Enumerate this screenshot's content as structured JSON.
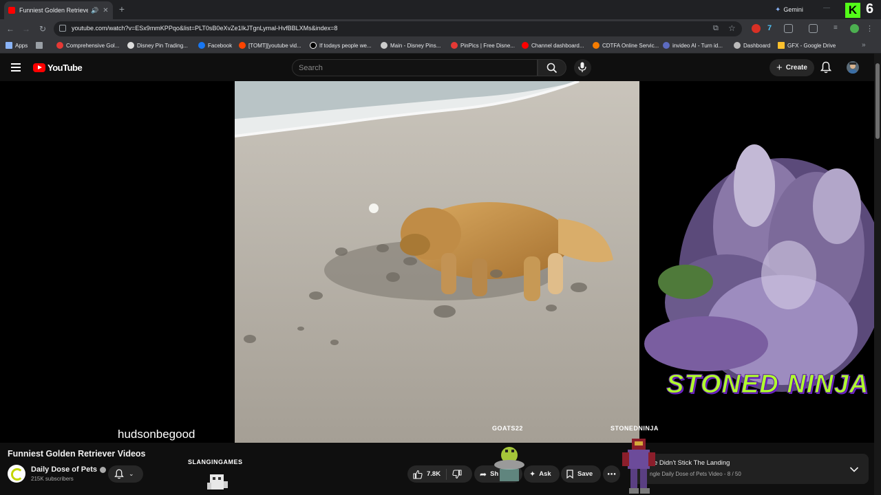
{
  "browser": {
    "tab_title": "Funniest Golden Retriever V",
    "new_tab": "+",
    "gemini_label": "Gemini",
    "kick_letter": "K",
    "overlay_count": "6",
    "url": "youtube.com/watch?v=ESx9mmKPPqo&list=PLT0sB0eXvZe1IkJTgnLymal-HvfBBLXMs&index=8",
    "bookmarks": [
      "Apps",
      "Comprehensive Gol...",
      "Disney Pin Trading...",
      "Facebook",
      "[TOMT][youtube vid...",
      "If todays people we...",
      "Main - Disney Pins...",
      "PinPics | Free Disne...",
      "Channel dashboard...",
      "CDTFA Online Servic...",
      "invideo AI - Turn id...",
      "Dashboard",
      "GFX - Google Drive"
    ],
    "colors": {
      "tabstrip": "#202124",
      "toolbar": "#35363a"
    }
  },
  "youtube": {
    "logo_text": "YouTube",
    "search_placeholder": "Search",
    "create_label": "Create",
    "colors": {
      "brand_red": "#ff0000",
      "background": "#0f0f0f",
      "pill": "#272727"
    }
  },
  "stream_overlay": {
    "username": "hudsonbegood",
    "tag_left": "GOATS22",
    "tag_right": "STONEDNINJA",
    "tag_bottom": "SLANGINGAMES",
    "brand_text": "STONED NINJA"
  },
  "video": {
    "title": "Funniest Golden Retriever Videos",
    "channel_name": "Daily Dose of Pets",
    "subscribers": "215K subscribers",
    "likes": "7.8K",
    "share_label": "Sh",
    "ask_label": "Ask",
    "save_label": "Save"
  },
  "playlist": {
    "current_title": "e Didn't Stick The Landing",
    "meta": "ngle Daily Dose of Pets Video - 8 / 50"
  }
}
